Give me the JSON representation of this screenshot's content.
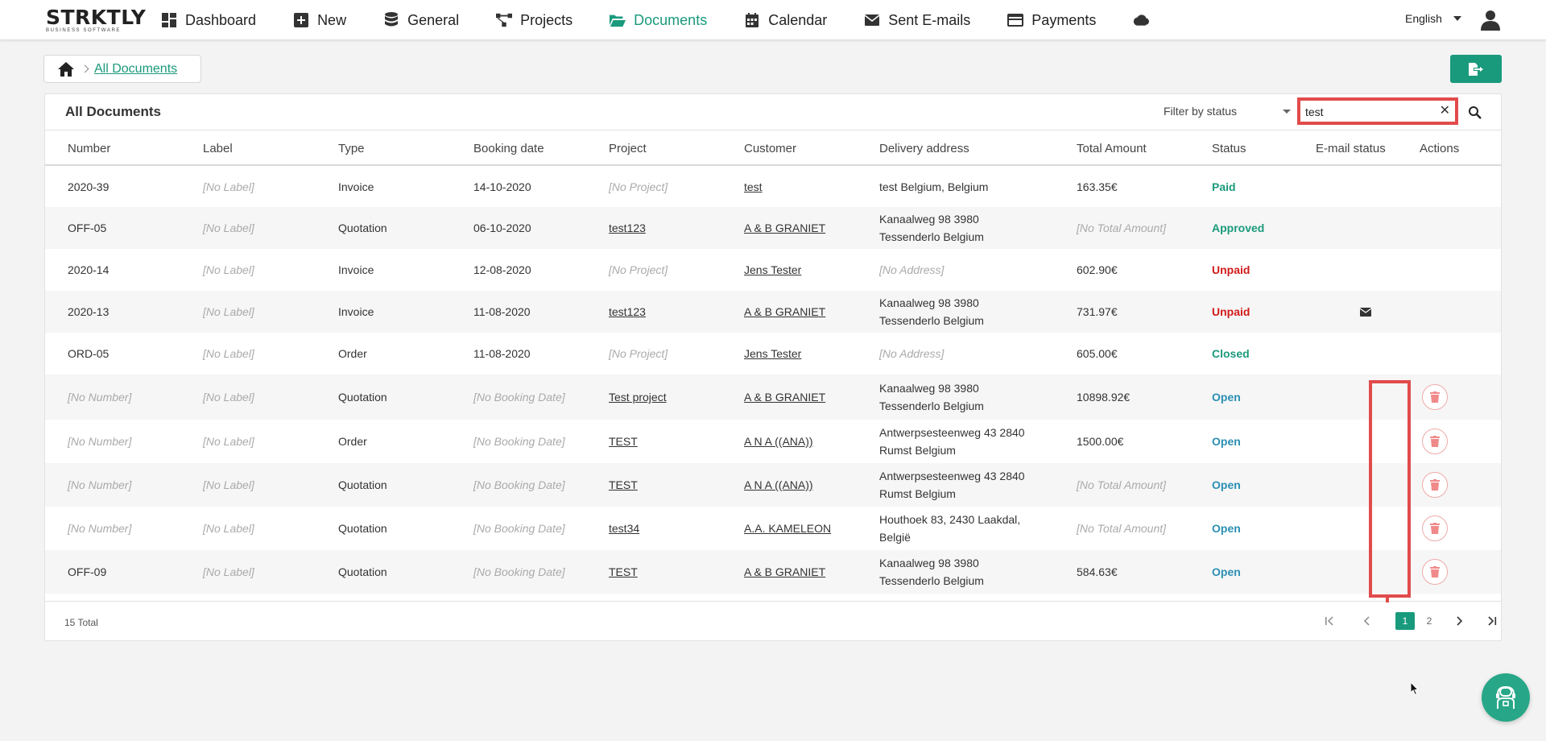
{
  "logo": {
    "brand": "STRKTLY",
    "tagline": "BUSINESS SOFTWARE"
  },
  "nav": {
    "items": [
      {
        "label": "Dashboard",
        "icon": "dashboard-icon"
      },
      {
        "label": "New",
        "icon": "plus-square-icon"
      },
      {
        "label": "General",
        "icon": "database-icon"
      },
      {
        "label": "Projects",
        "icon": "project-diagram-icon"
      },
      {
        "label": "Documents",
        "icon": "folder-open-icon",
        "active": true
      },
      {
        "label": "Calendar",
        "icon": "calendar-icon"
      },
      {
        "label": "Sent E-mails",
        "icon": "envelope-icon"
      },
      {
        "label": "Payments",
        "icon": "credit-card-icon"
      },
      {
        "label": "",
        "icon": "cloud-icon"
      }
    ],
    "language": "English"
  },
  "breadcrumb": {
    "current": "All Documents"
  },
  "panel": {
    "title": "All Documents",
    "filter_placeholder": "Filter by status",
    "search_value": "test",
    "clear_symbol": "✕"
  },
  "table": {
    "columns": [
      "Number",
      "Label",
      "Type",
      "Booking date",
      "Project",
      "Customer",
      "Delivery address",
      "Total Amount",
      "Status",
      "E-mail status",
      "Actions"
    ],
    "rows": [
      {
        "number": "2020-39",
        "label": "[No Label]",
        "type": "Invoice",
        "booking_date": "14-10-2020",
        "project": "[No Project]",
        "customer": "test",
        "address1": "test Belgium, Belgium",
        "address2": "",
        "total": "163.35€",
        "status": "Paid",
        "email": false,
        "delete": false
      },
      {
        "number": "OFF-05",
        "label": "[No Label]",
        "type": "Quotation",
        "booking_date": "06-10-2020",
        "project": "test123",
        "customer": "A & B GRANIET",
        "address1": "Kanaalweg 98 3980",
        "address2": "Tessenderlo Belgium",
        "total": "[No Total Amount]",
        "status": "Approved",
        "email": false,
        "delete": false
      },
      {
        "number": "2020-14",
        "label": "[No Label]",
        "type": "Invoice",
        "booking_date": "12-08-2020",
        "project": "[No Project]",
        "customer": "Jens Tester",
        "address1": "[No Address]",
        "address2": "",
        "total": "602.90€",
        "status": "Unpaid",
        "email": false,
        "delete": false
      },
      {
        "number": "2020-13",
        "label": "[No Label]",
        "type": "Invoice",
        "booking_date": "11-08-2020",
        "project": "test123",
        "customer": "A & B GRANIET",
        "address1": "Kanaalweg 98 3980",
        "address2": "Tessenderlo Belgium",
        "total": "731.97€",
        "status": "Unpaid",
        "email": true,
        "delete": false
      },
      {
        "number": "ORD-05",
        "label": "[No Label]",
        "type": "Order",
        "booking_date": "11-08-2020",
        "project": "[No Project]",
        "customer": "Jens Tester",
        "address1": "[No Address]",
        "address2": "",
        "total": "605.00€",
        "status": "Closed",
        "email": false,
        "delete": false
      },
      {
        "number": "[No Number]",
        "label": "[No Label]",
        "type": "Quotation",
        "booking_date": "[No Booking Date]",
        "project": "Test project",
        "customer": "A & B GRANIET",
        "address1": "Kanaalweg 98 3980",
        "address2": "Tessenderlo Belgium",
        "total": "10898.92€",
        "status": "Open",
        "email": false,
        "delete": true
      },
      {
        "number": "[No Number]",
        "label": "[No Label]",
        "type": "Order",
        "booking_date": "[No Booking Date]",
        "project": "TEST",
        "customer": "A N A ((ANA))",
        "address1": "Antwerpsesteenweg 43 2840",
        "address2": "Rumst Belgium",
        "total": "1500.00€",
        "status": "Open",
        "email": false,
        "delete": true
      },
      {
        "number": "[No Number]",
        "label": "[No Label]",
        "type": "Quotation",
        "booking_date": "[No Booking Date]",
        "project": "TEST",
        "customer": "A N A ((ANA))",
        "address1": "Antwerpsesteenweg 43 2840",
        "address2": "Rumst Belgium",
        "total": "[No Total Amount]",
        "status": "Open",
        "email": false,
        "delete": true
      },
      {
        "number": "[No Number]",
        "label": "[No Label]",
        "type": "Quotation",
        "booking_date": "[No Booking Date]",
        "project": "test34",
        "customer": "A.A. KAMELEON",
        "address1": "Houthoek 83, 2430 Laakdal,",
        "address2": "België",
        "total": "[No Total Amount]",
        "status": "Open",
        "email": false,
        "delete": true
      },
      {
        "number": "OFF-09",
        "label": "[No Label]",
        "type": "Quotation",
        "booking_date": "[No Booking Date]",
        "project": "TEST",
        "customer": "A & B GRANIET",
        "address1": "Kanaalweg 98 3980",
        "address2": "Tessenderlo Belgium",
        "total": "584.63€",
        "status": "Open",
        "email": false,
        "delete": true
      }
    ]
  },
  "footer": {
    "total": "15 Total",
    "pages": [
      "1",
      "2"
    ],
    "current_page": "1"
  },
  "colors": {
    "accent": "#1a9a7c",
    "unpaid": "#d11b1b",
    "open": "#2b8fb3",
    "highlight": "#e14b4b"
  }
}
